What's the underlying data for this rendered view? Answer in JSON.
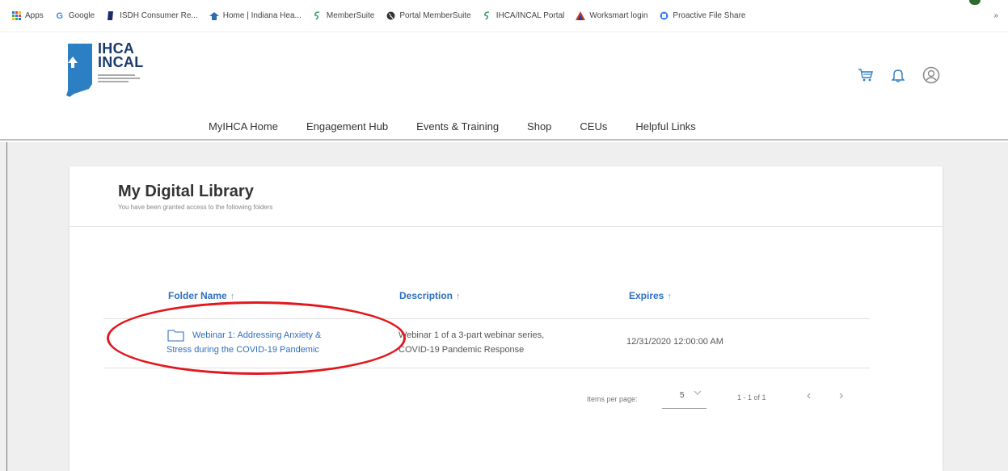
{
  "bookmarks": [
    {
      "label": "Apps",
      "icon": "apps-grid-icon",
      "color": "#1a73e8"
    },
    {
      "label": "Google",
      "icon": "google-icon",
      "color": "#4285f4"
    },
    {
      "label": "ISDH Consumer Re...",
      "icon": "bookmark-icon",
      "color": "#1b2b6b"
    },
    {
      "label": "Home | Indiana Hea...",
      "icon": "home-icon",
      "color": "#2a6db5"
    },
    {
      "label": "MemberSuite",
      "icon": "membersuite-icon",
      "color": "#38a169"
    },
    {
      "label": "Portal MemberSuite",
      "icon": "globe-icon",
      "color": "#333333"
    },
    {
      "label": "IHCA/INCAL Portal",
      "icon": "membersuite-icon",
      "color": "#38a169"
    },
    {
      "label": "Worksmart login",
      "icon": "triangle-icon",
      "color": "#c0392b"
    },
    {
      "label": "Proactive File Share",
      "icon": "fileshare-icon",
      "color": "#3b82f6"
    }
  ],
  "bookmarks_more": "»",
  "logo": {
    "line1": "IHCA",
    "line2": "INCAL"
  },
  "nav": [
    "MyIHCA Home",
    "Engagement Hub",
    "Events & Training",
    "Shop",
    "CEUs",
    "Helpful Links"
  ],
  "card": {
    "title": "My Digital Library",
    "subtitle": "You have been granted access to the following folders"
  },
  "table": {
    "headers": {
      "folder": "Folder Name",
      "description": "Description",
      "expires": "Expires"
    },
    "sort_arrow": "↑",
    "rows": [
      {
        "name_line1": "Webinar 1: Addressing Anxiety &",
        "name_line2": "Stress during the COVID-19 Pandemic",
        "desc_line1": "Webinar 1 of a 3-part webinar series,",
        "desc_line2": "COVID-19 Pandemic Response",
        "expires": "12/31/2020 12:00:00 AM"
      }
    ]
  },
  "pager": {
    "label": "Items per page:",
    "value": "5",
    "range": "1 - 1 of 1",
    "prev": "‹",
    "next": "›"
  },
  "colors": {
    "link": "#2e6fbf",
    "annotation": "#e3171e",
    "brand": "#1a3a6b"
  }
}
